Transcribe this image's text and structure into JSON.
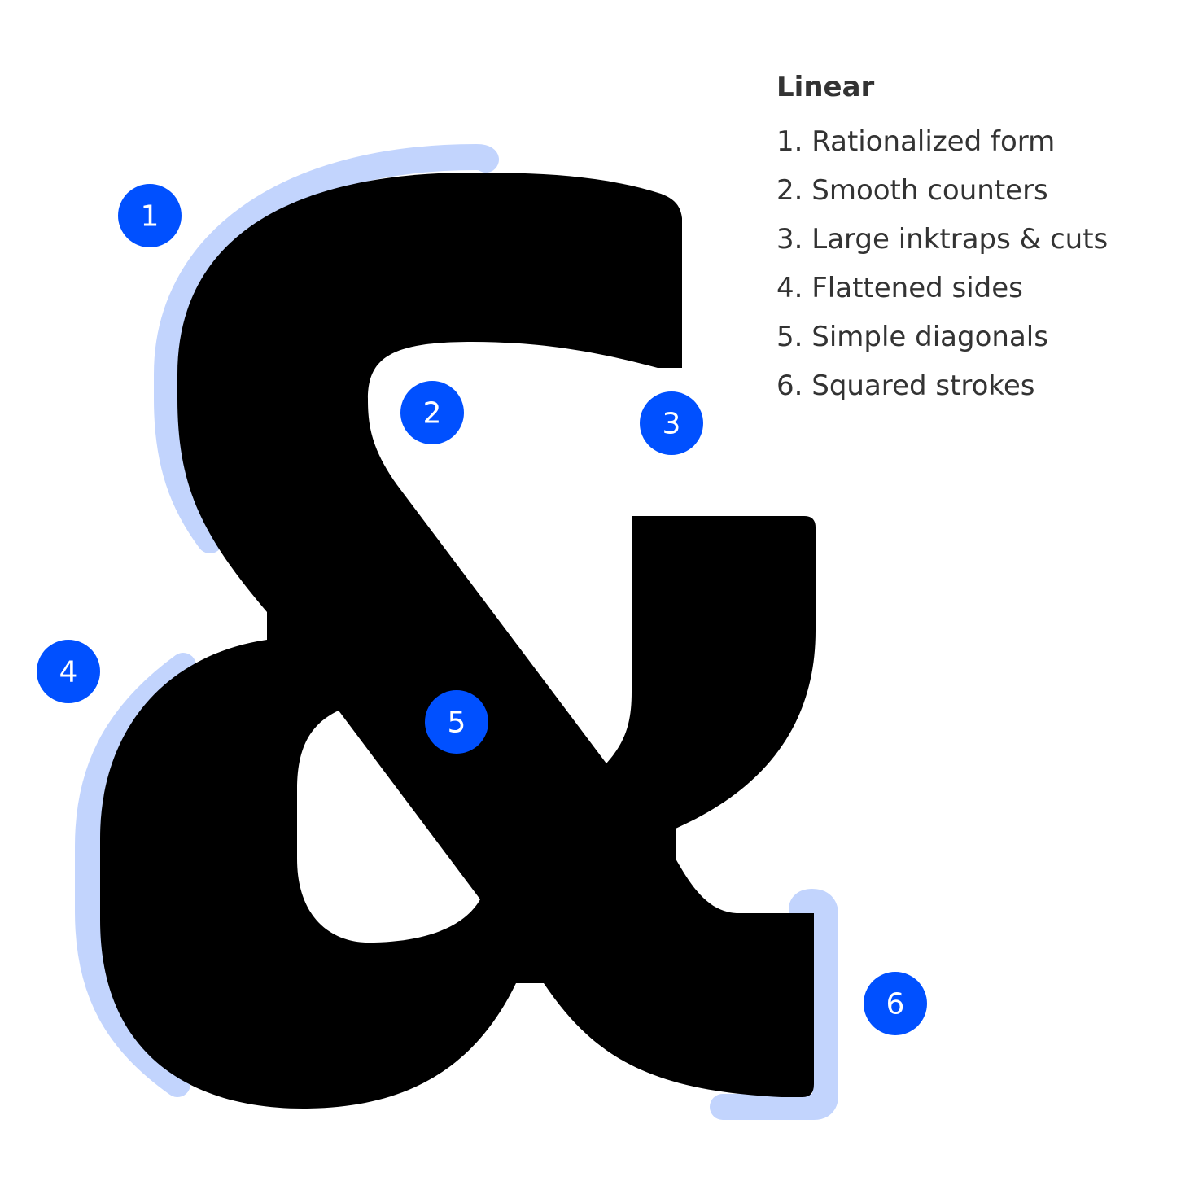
{
  "legend": {
    "title": "Linear",
    "items": [
      "1. Rationalized form",
      "2. Smooth counters",
      "3. Large inktraps & cuts",
      "4. Flattened sides",
      "5. Simple diagonals",
      "6. Squared strokes"
    ]
  },
  "markers": [
    "1",
    "2",
    "3",
    "4",
    "5",
    "6"
  ],
  "colors": {
    "marker_fill": "#0050FF",
    "highlight": "#C2D4FD",
    "glyph": "#000000",
    "text": "#333333",
    "background": "#FFFFFF"
  }
}
